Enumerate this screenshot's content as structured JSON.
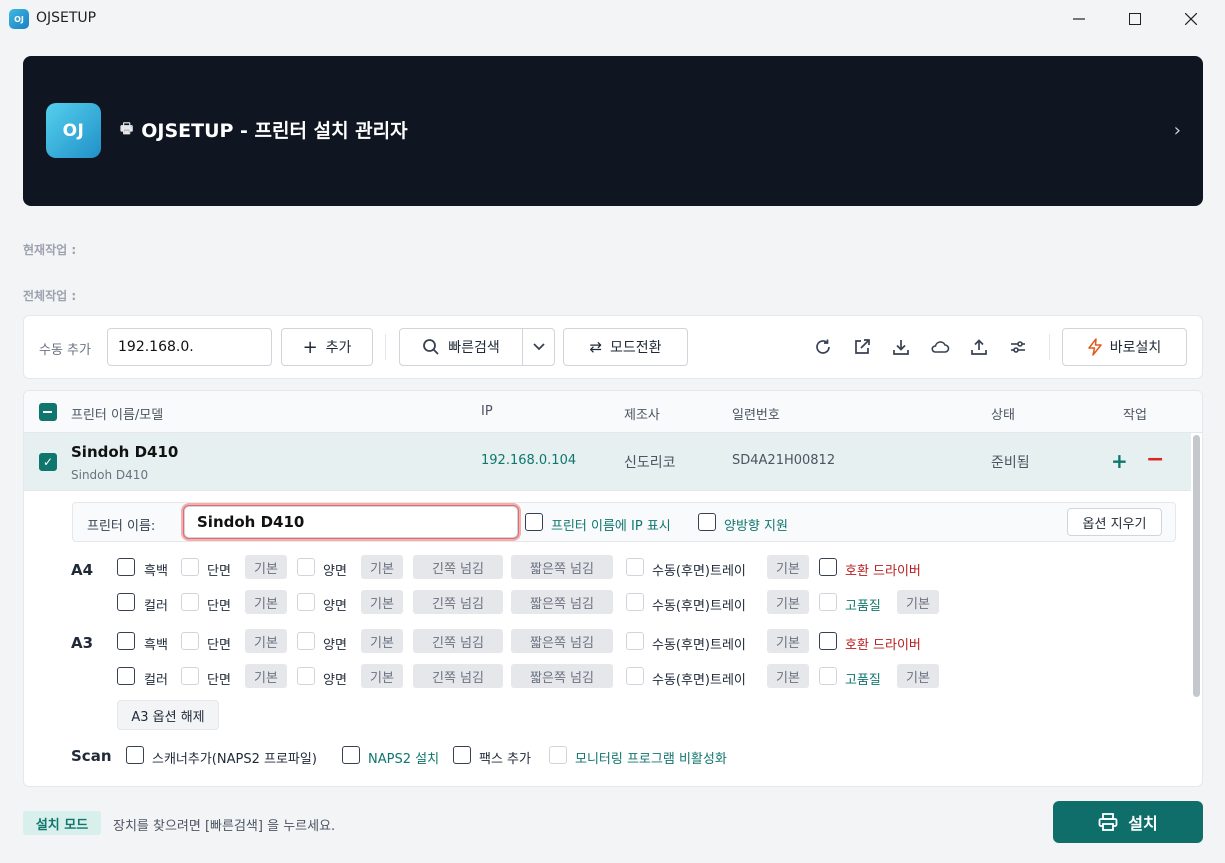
{
  "window": {
    "title": "OJSETUP",
    "icon_text": "OJ"
  },
  "banner": {
    "logo_text": "OJ",
    "title": "OJSETUP - 프린터 설치 관리자"
  },
  "status": {
    "current_label": "현재작업 :",
    "total_label": "전체작업 :"
  },
  "toolbar": {
    "manual_add_label": "수동 추가",
    "ip_value": "192.168.0.",
    "add_label": "추가",
    "search_label": "빠른검색",
    "mode_label": "모드전환",
    "quick_install_label": "바로설치"
  },
  "table": {
    "headers": {
      "name": "프린터 이름/모델",
      "ip": "IP",
      "maker": "제조사",
      "serial": "일련번호",
      "status": "상태",
      "action": "작업"
    },
    "rows": [
      {
        "name": "Sindoh D410",
        "model": "Sindoh D410",
        "ip": "192.168.0.104",
        "maker": "신도리코",
        "serial": "SD4A21H00812",
        "status": "준비됨"
      }
    ]
  },
  "options": {
    "printer_name_label": "프린터 이름:",
    "printer_name_value": "Sindoh D410",
    "show_ip_label": "프린터 이름에 IP 표시",
    "duplex_support_label": "양방향 지원",
    "clear_label": "옵션 지우기",
    "a4_label": "A4",
    "a3_label": "A3",
    "scan_label": "Scan",
    "mono": "흑백",
    "color": "컬러",
    "simplex": "단면",
    "duplex": "양면",
    "default": "기본",
    "long_edge": "긴쪽 넘김",
    "short_edge": "짧은쪽 넘김",
    "manual_tray": "수동(후면)트레이",
    "compat_driver": "호환 드라이버",
    "high_quality": "고품질",
    "a3_release": "A3 옵션 해제",
    "scanner_add": "스캐너추가(NAPS2 프로파일)",
    "naps2_install": "NAPS2 설치",
    "fax_add": "팩스 추가",
    "monitor_disable": "모니터링 프로그램 비활성화"
  },
  "footer": {
    "mode_badge": "설치 모드",
    "hint": "장치를 찾으려면 [빠른검색] 을 누르세요.",
    "install_label": "설치"
  },
  "colors": {
    "accent": "#0f766e",
    "banner_bg": "#0f1521",
    "danger": "#dc2626"
  }
}
